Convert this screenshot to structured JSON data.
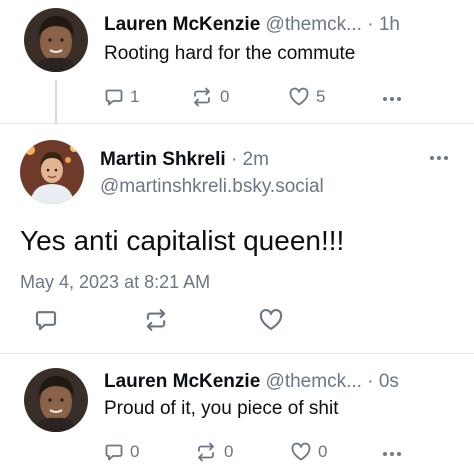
{
  "posts": [
    {
      "display_name": "Lauren McKenzie",
      "handle": "@themck...",
      "separator": "·",
      "time": "1h",
      "text": "Rooting hard for the commute",
      "replies": "1",
      "reposts": "0",
      "likes": "5"
    },
    {
      "display_name": "Martin Shkreli",
      "separator": "·",
      "time": "2m",
      "handle": "@martinshkreli.bsky.social",
      "text": "Yes anti capitalist queen!!!",
      "timestamp": "May 4, 2023 at 8:21 AM"
    },
    {
      "display_name": "Lauren McKenzie",
      "handle": "@themck...",
      "separator": "·",
      "time": "0s",
      "text": "Proud of it, you piece of shit",
      "replies": "0",
      "reposts": "0",
      "likes": "0"
    }
  ],
  "colors": {
    "muted": "#6b7785",
    "text": "#0b0f14",
    "divider": "#e5e8eb",
    "thread_line": "#d4dbe2"
  },
  "icons": [
    "reply-icon",
    "repost-icon",
    "like-icon",
    "more-options-icon"
  ]
}
